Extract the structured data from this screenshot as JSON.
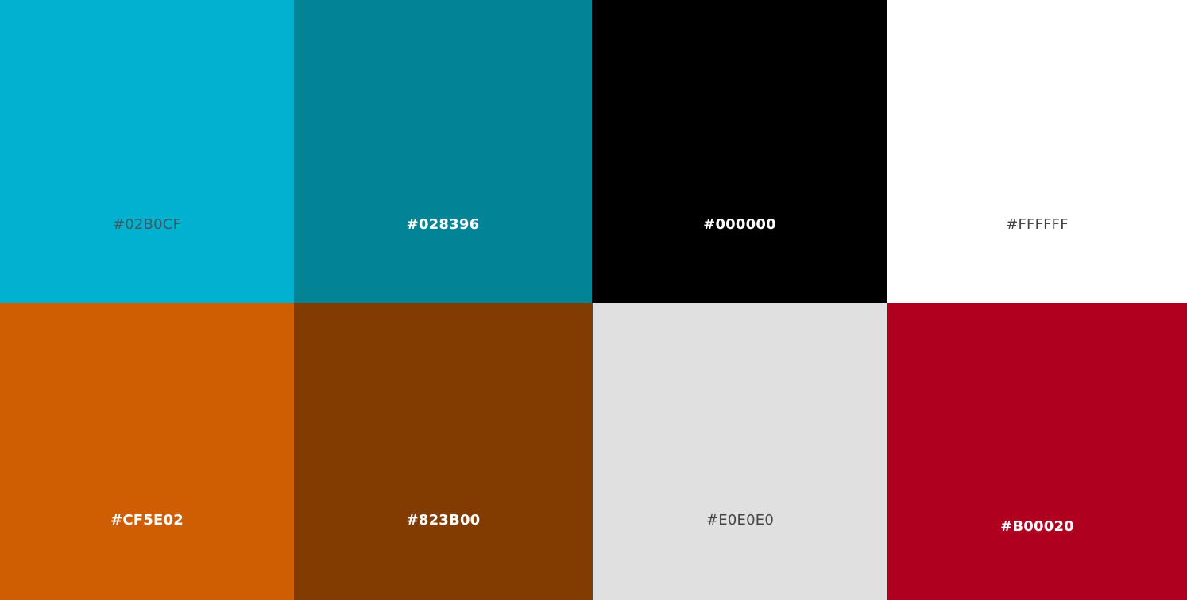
{
  "swatches": [
    {
      "hex": "#02B0CF",
      "label": "#02B0CF",
      "text_color": "#3d5a60",
      "bold": false
    },
    {
      "hex": "#028396",
      "label": "#028396",
      "text_color": "#ffffff",
      "bold": true
    },
    {
      "hex": "#000000",
      "label": "#000000",
      "text_color": "#ffffff",
      "bold": true
    },
    {
      "hex": "#FFFFFF",
      "label": "#FFFFFF",
      "text_color": "#444444",
      "bold": false
    },
    {
      "hex": "#CF5E02",
      "label": "#CF5E02",
      "text_color": "#ffffff",
      "bold": true
    },
    {
      "hex": "#823B00",
      "label": "#823B00",
      "text_color": "#ffffff",
      "bold": true
    },
    {
      "hex": "#E0E0E0",
      "label": "#E0E0E0",
      "text_color": "#444444",
      "bold": false
    },
    {
      "hex": "#B00020",
      "label": "#B00020",
      "text_color": "#ffffff",
      "bold": true
    }
  ]
}
